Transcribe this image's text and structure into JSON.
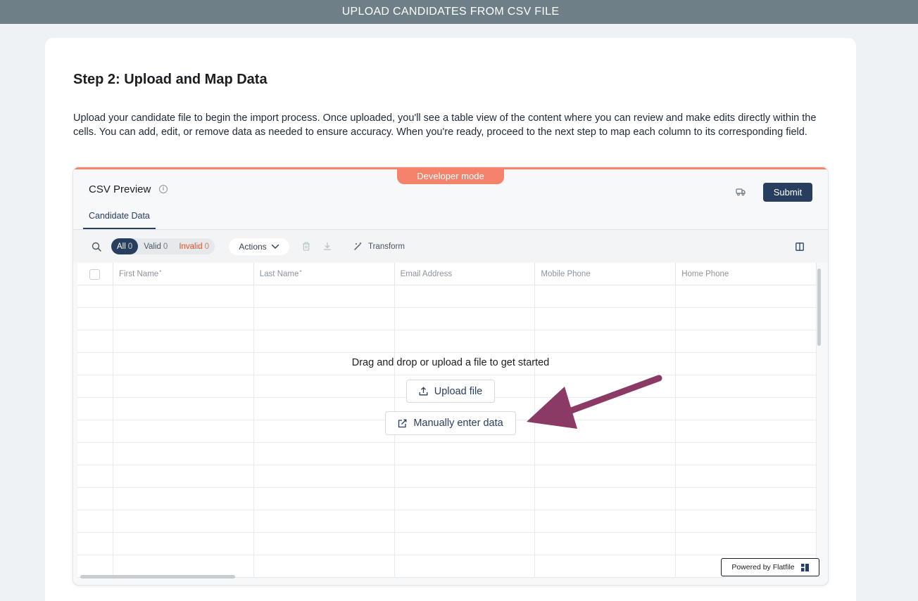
{
  "header": {
    "title": "UPLOAD CANDIDATES FROM CSV FILE"
  },
  "step": {
    "title": "Step 2: Upload and Map Data",
    "description": "Upload your candidate file to begin the import process. Once uploaded, you'll see a table view of the content where you can review and make edits directly within the cells. You can add, edit, or remove data as needed to ensure accuracy. When you're ready, proceed to the next step to map each column to its corresponding field."
  },
  "widget": {
    "badge": "Developer mode",
    "title": "CSV Preview",
    "submit_label": "Submit",
    "tab": "Candidate Data",
    "accent_color": "#f5826a",
    "primary_color": "#273e5e",
    "filters": {
      "all_label": "All",
      "all_count": "0",
      "valid_label": "Valid",
      "valid_count": "0",
      "invalid_label": "Invalid",
      "invalid_count": "0"
    },
    "actions_label": "Actions",
    "transform_label": "Transform",
    "columns": [
      {
        "label": "First Name",
        "required": "*"
      },
      {
        "label": "Last Name",
        "required": "*"
      },
      {
        "label": "Email Address",
        "required": ""
      },
      {
        "label": "Mobile Phone",
        "required": ""
      },
      {
        "label": "Home Phone",
        "required": ""
      }
    ],
    "empty_message": "Drag and drop or upload a file to get started",
    "upload_label": "Upload file",
    "manual_label": "Manually enter data",
    "powered_label": "Powered by Flatfile"
  },
  "icons": {
    "info": "info-icon",
    "truck": "truck-icon",
    "search": "search-icon",
    "chevron": "chevron-down-icon",
    "trash": "trash-icon",
    "download": "download-icon",
    "wand": "wand-icon",
    "columns": "columns-icon",
    "upload": "upload-icon",
    "edit": "edit-icon",
    "logo": "flatfile-logo-icon",
    "arrow": "arrow-annotation"
  }
}
